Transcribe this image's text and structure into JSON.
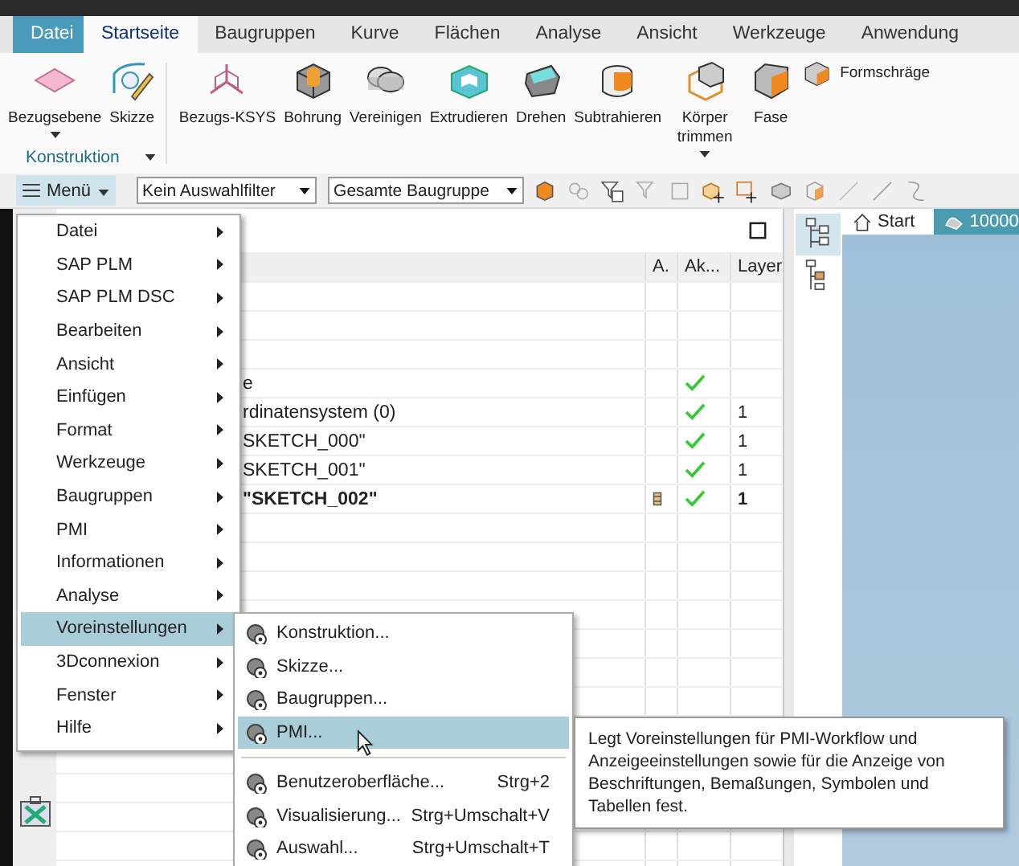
{
  "tabs": [
    {
      "label": "Datei",
      "kind": "file",
      "selected": false
    },
    {
      "label": "Startseite",
      "kind": "tab",
      "selected": true
    },
    {
      "label": "Baugruppen",
      "kind": "tab",
      "selected": false
    },
    {
      "label": "Kurve",
      "kind": "tab",
      "selected": false
    },
    {
      "label": "Flächen",
      "kind": "tab",
      "selected": false
    },
    {
      "label": "Analyse",
      "kind": "tab",
      "selected": false
    },
    {
      "label": "Ansicht",
      "kind": "tab",
      "selected": false
    },
    {
      "label": "Werkzeuge",
      "kind": "tab",
      "selected": false
    },
    {
      "label": "Anwendung",
      "kind": "tab",
      "selected": false
    }
  ],
  "ribbon": {
    "group": "Konstruktion",
    "tools": [
      {
        "label": "Bezugsebene",
        "kind": "plane",
        "dropdown": true
      },
      {
        "label": "Skizze",
        "kind": "sketch",
        "dropdown": false
      },
      {
        "label": "Bezugs-KSYS",
        "kind": "csys",
        "dropdown": false
      },
      {
        "label": "Bohrung",
        "kind": "hole",
        "dropdown": false
      },
      {
        "label": "Vereinigen",
        "kind": "unite",
        "dropdown": false
      },
      {
        "label": "Extrudieren",
        "kind": "extrude",
        "dropdown": false
      },
      {
        "label": "Drehen",
        "kind": "revolve",
        "dropdown": false
      },
      {
        "label": "Subtrahieren",
        "kind": "subtract",
        "dropdown": false
      },
      {
        "label": "Körper trimmen",
        "kind": "trim",
        "dropdown": true
      },
      {
        "label": "Fase",
        "kind": "chamfer",
        "dropdown": false
      },
      {
        "label": "Formschräge",
        "kind": "draft",
        "dropdown": false
      }
    ]
  },
  "toolbar": {
    "menu_button": "Menü",
    "filters": [
      "Kein Auswahlfilter",
      "Gesamte Baugruppe"
    ]
  },
  "navigator": {
    "columns": [
      "A.",
      "Ak...",
      "Layer"
    ],
    "rows": [
      {
        "name": "e",
        "active": true,
        "layer": "",
        "bold": false,
        "attribute_icon": false
      },
      {
        "name": "rdinatensystem (0)",
        "active": true,
        "layer": "1",
        "bold": false,
        "attribute_icon": false
      },
      {
        "name": "SKETCH_000\"",
        "active": true,
        "layer": "1",
        "bold": false,
        "attribute_icon": false
      },
      {
        "name": "SKETCH_001\"",
        "active": true,
        "layer": "1",
        "bold": false,
        "attribute_icon": false
      },
      {
        "name": "\"SKETCH_002\"",
        "active": true,
        "layer": "1",
        "bold": true,
        "attribute_icon": true
      }
    ]
  },
  "viewport_tabs": [
    {
      "label": "Start",
      "kind": "home",
      "selected": false
    },
    {
      "label": "10000",
      "kind": "part",
      "selected": true
    }
  ],
  "menu": {
    "items": [
      {
        "label": "Datei",
        "selected": false
      },
      {
        "label": "SAP PLM",
        "selected": false
      },
      {
        "label": "SAP PLM DSC",
        "selected": false
      },
      {
        "label": "Bearbeiten",
        "selected": false
      },
      {
        "label": "Ansicht",
        "selected": false
      },
      {
        "label": "Einfügen",
        "selected": false
      },
      {
        "label": "Format",
        "selected": false
      },
      {
        "label": "Werkzeuge",
        "selected": false
      },
      {
        "label": "Baugruppen",
        "selected": false
      },
      {
        "label": "PMI",
        "selected": false
      },
      {
        "label": "Informationen",
        "selected": false
      },
      {
        "label": "Analyse",
        "selected": false
      },
      {
        "label": "Voreinstellungen",
        "selected": true
      },
      {
        "label": "3Dconnexion",
        "selected": false
      },
      {
        "label": "Fenster",
        "selected": false
      },
      {
        "label": "Hilfe",
        "selected": false
      }
    ]
  },
  "submenu": {
    "items": [
      {
        "label": "Konstruktion...",
        "kind": "item",
        "selected": false
      },
      {
        "label": "Skizze...",
        "kind": "item",
        "selected": false
      },
      {
        "label": "Baugruppen...",
        "kind": "item",
        "selected": false
      },
      {
        "label": "PMI...",
        "kind": "item",
        "selected": true
      },
      {
        "kind": "separator"
      },
      {
        "label": "Benutzeroberfläche...",
        "kind": "item",
        "shortcut": "Strg+2",
        "selected": false
      },
      {
        "label": "Visualisierung...",
        "kind": "item",
        "shortcut": "Strg+Umschalt+V",
        "selected": false
      },
      {
        "label": "Auswahl...",
        "kind": "item",
        "shortcut": "Strg+Umschalt+T",
        "selected": false
      }
    ]
  },
  "tooltip": "Legt Voreinstellungen für PMI-Workflow und Anzeigeeinstellungen sowie für die Anzeige von Beschriftungen, Bemaßungen, Symbolen und Tabellen fest."
}
